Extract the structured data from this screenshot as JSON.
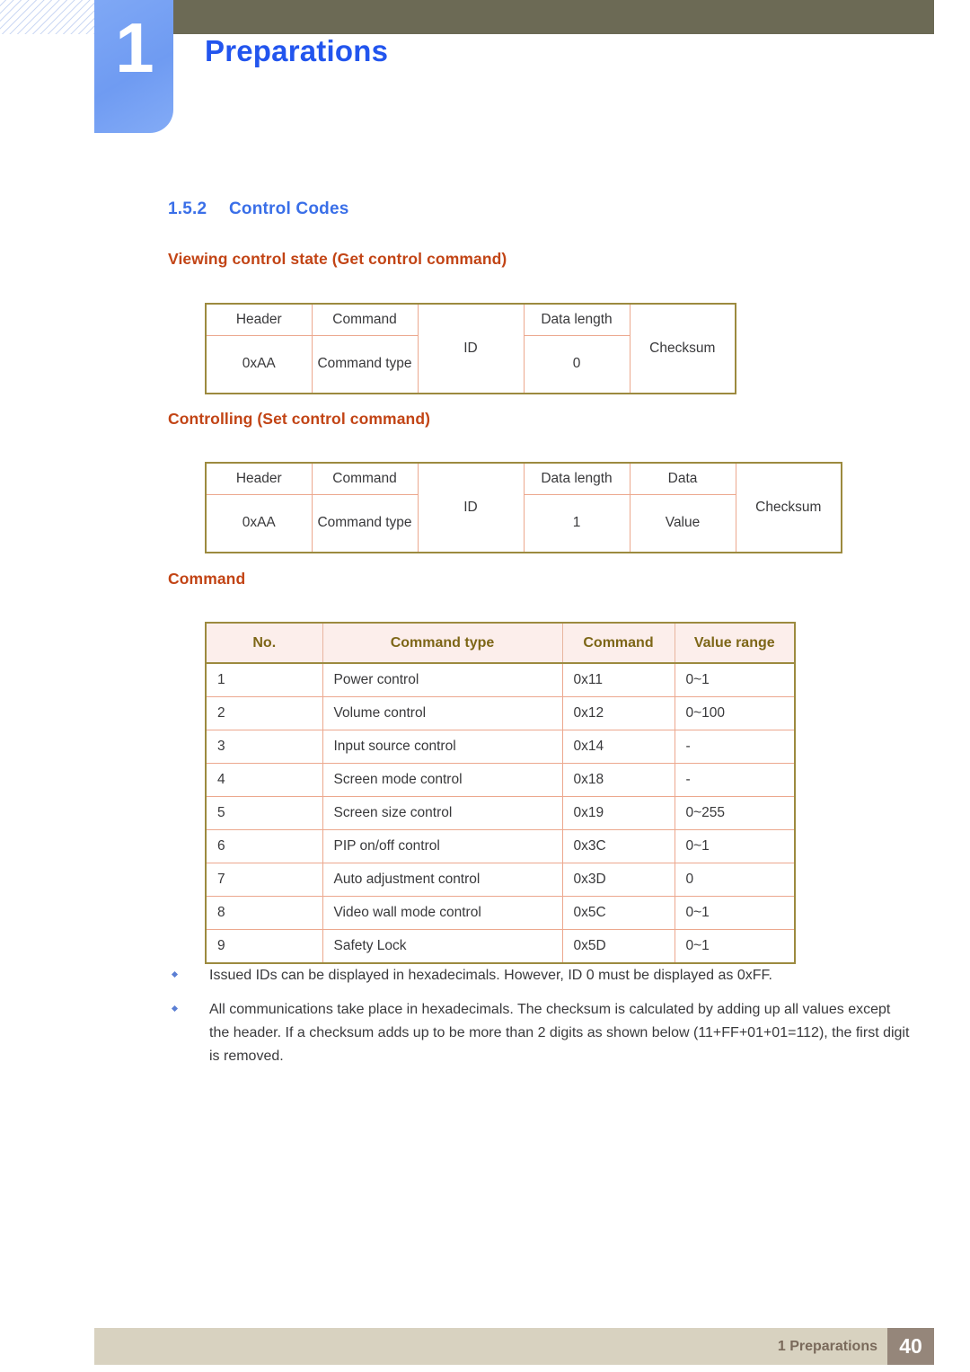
{
  "header": {
    "chapter_number": "1",
    "chapter_title": "Preparations"
  },
  "section": {
    "number": "1.5.2",
    "title": "Control Codes"
  },
  "subheadings": {
    "get": "Viewing control state (Get control command)",
    "set": "Controlling (Set control command)",
    "command": "Command"
  },
  "get_frame": {
    "row1": [
      "Header",
      "Command",
      "ID",
      "Data length",
      "Checksum"
    ],
    "row2": [
      "0xAA",
      "Command type",
      "",
      "0",
      ""
    ]
  },
  "set_frame": {
    "row1": [
      "Header",
      "Command",
      "ID",
      "Data length",
      "Data",
      "Checksum"
    ],
    "row2": [
      "0xAA",
      "Command type",
      "",
      "1",
      "Value",
      ""
    ]
  },
  "command_table": {
    "headers": [
      "No.",
      "Command type",
      "Command",
      "Value range"
    ],
    "rows": [
      [
        "1",
        "Power control",
        "0x11",
        "0~1"
      ],
      [
        "2",
        "Volume control",
        "0x12",
        "0~100"
      ],
      [
        "3",
        "Input source control",
        "0x14",
        "-"
      ],
      [
        "4",
        "Screen mode control",
        "0x18",
        "-"
      ],
      [
        "5",
        "Screen size control",
        "0x19",
        "0~255"
      ],
      [
        "6",
        "PIP on/off control",
        "0x3C",
        "0~1"
      ],
      [
        "7",
        "Auto adjustment control",
        "0x3D",
        "0"
      ],
      [
        "8",
        "Video wall mode control",
        "0x5C",
        "0~1"
      ],
      [
        "9",
        "Safety Lock",
        "0x5D",
        "0~1"
      ]
    ]
  },
  "notes": [
    "Issued IDs can be displayed in hexadecimals. However, ID 0 must be displayed as 0xFF.",
    "All communications take place in hexadecimals. The checksum is calculated by adding up all values except the header. If a checksum adds up to be more than 2 digits as shown below (11+FF+01+01=112), the first digit is removed."
  ],
  "footer": {
    "label": "1 Preparations",
    "page": "40"
  },
  "colors": {
    "olive_bar": "#6c6a55",
    "chapter_blue": "#7fa8f5",
    "title_blue": "#2255ee",
    "section_blue": "#3a6fe8",
    "subheading_orange": "#c24415",
    "table_border_gold": "#9c8a3f",
    "table_grid_salmon": "#eca88e",
    "table_header_bg": "#fceeeb",
    "table_header_text": "#7d6617",
    "footer_bar": "#d8d2c0",
    "footer_page_bg": "#95867a"
  }
}
